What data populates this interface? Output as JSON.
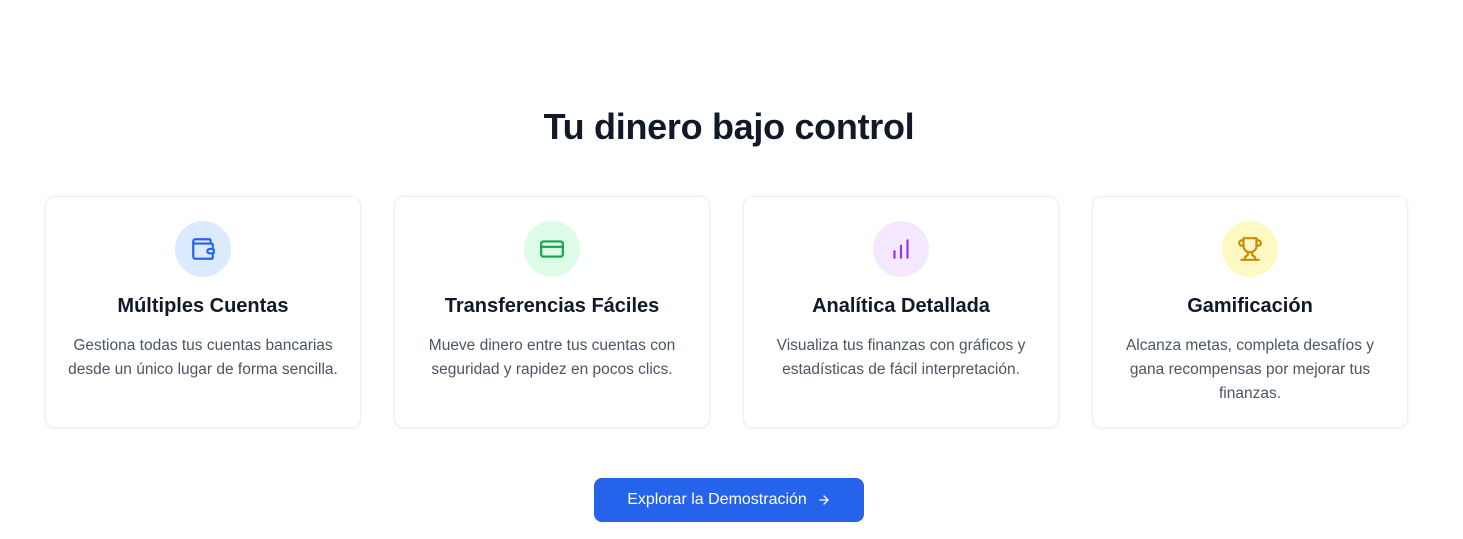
{
  "section": {
    "title": "Tu dinero bajo control"
  },
  "features": [
    {
      "icon": "wallet-icon",
      "color": "#2563eb",
      "bg": "#dbeafe",
      "title": "Múltiples Cuentas",
      "description": "Gestiona todas tus cuentas bancarias desde un único lugar de forma sencilla."
    },
    {
      "icon": "credit-card-icon",
      "color": "#16a34a",
      "bg": "#dcfce7",
      "title": "Transferencias Fáciles",
      "description": "Mueve dinero entre tus cuentas con seguridad y rapidez en pocos clics."
    },
    {
      "icon": "bar-chart-icon",
      "color": "#9333ea",
      "bg": "#f3e8ff",
      "title": "Analítica Detallada",
      "description": "Visualiza tus finanzas con gráficos y estadísticas de fácil interpretación."
    },
    {
      "icon": "trophy-icon",
      "color": "#ca8a04",
      "bg": "#fef9c3",
      "title": "Gamificación",
      "description": "Alcanza metas, completa desafíos y gana recompensas por mejorar tus finanzas."
    }
  ],
  "cta": {
    "label": "Explorar la Demostración",
    "icon": "arrow-right-icon",
    "color": "#2563eb"
  }
}
